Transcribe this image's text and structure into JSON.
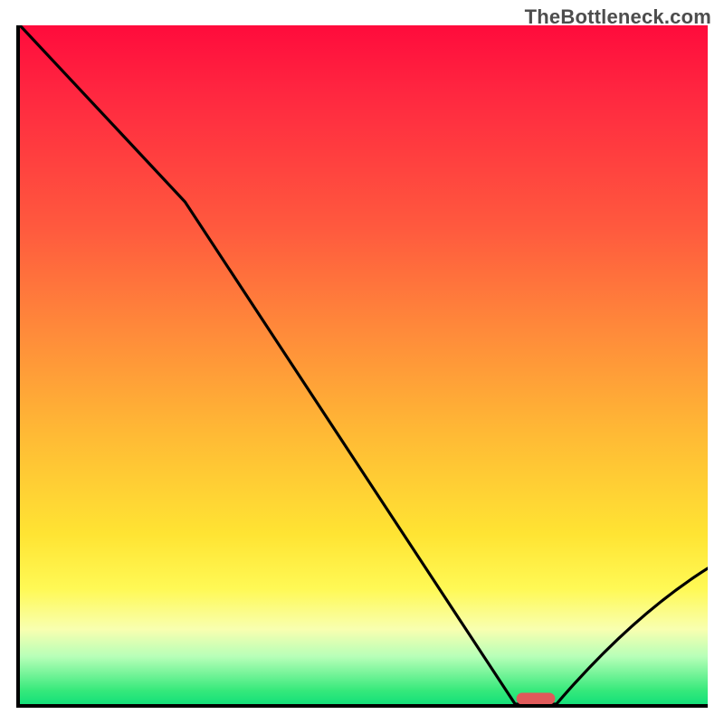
{
  "watermark": "TheBottleneck.com",
  "chart_data": {
    "type": "line",
    "title": "",
    "xlabel": "",
    "ylabel": "",
    "xlim": [
      0,
      100
    ],
    "ylim": [
      0,
      100
    ],
    "grid": false,
    "legend": false,
    "background": "rainbow-vertical",
    "series": [
      {
        "name": "bottleneck-curve",
        "x": [
          0,
          24,
          72,
          78,
          100
        ],
        "y": [
          100,
          74,
          0,
          0,
          20
        ]
      }
    ],
    "marker": {
      "x_center": 75,
      "y": 0,
      "width_frac": 5.5
    }
  }
}
